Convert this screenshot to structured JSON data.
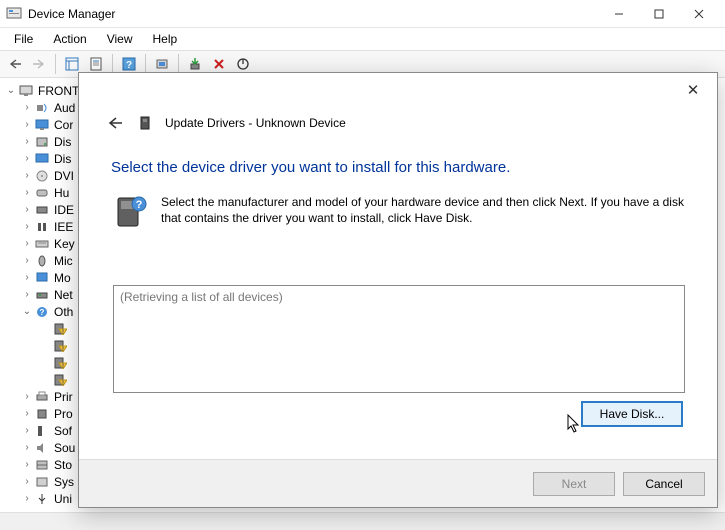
{
  "window": {
    "title": "Device Manager"
  },
  "menu": [
    "File",
    "Action",
    "View",
    "Help"
  ],
  "tree": {
    "root": "FRONT",
    "items": [
      {
        "label": "Aud",
        "icon": "audio"
      },
      {
        "label": "Cor",
        "icon": "computer"
      },
      {
        "label": "Dis",
        "icon": "disk"
      },
      {
        "label": "Dis",
        "icon": "display"
      },
      {
        "label": "DVI",
        "icon": "dvd"
      },
      {
        "label": "Hu",
        "icon": "hid"
      },
      {
        "label": "IDE",
        "icon": "ide"
      },
      {
        "label": "IEE",
        "icon": "ieee"
      },
      {
        "label": "Key",
        "icon": "keyboard"
      },
      {
        "label": "Mic",
        "icon": "mouse"
      },
      {
        "label": "Mo",
        "icon": "monitor"
      },
      {
        "label": "Net",
        "icon": "network"
      },
      {
        "label": "Oth",
        "icon": "other",
        "expanded": true,
        "children": 4
      },
      {
        "label": "Prir",
        "icon": "printer"
      },
      {
        "label": "Pro",
        "icon": "processor"
      },
      {
        "label": "Sof",
        "icon": "software"
      },
      {
        "label": "Sou",
        "icon": "sound"
      },
      {
        "label": "Sto",
        "icon": "storage"
      },
      {
        "label": "Sys",
        "icon": "system"
      },
      {
        "label": "Uni",
        "icon": "usb"
      }
    ]
  },
  "dialog": {
    "title_prefix": "Update Drivers - ",
    "device_name": "Unknown Device",
    "heading": "Select the device driver you want to install for this hardware.",
    "instruction": "Select the manufacturer and model of your hardware device and then click Next. If you have a disk that contains the driver you want to install, click Have Disk.",
    "list_placeholder": "(Retrieving a list of all devices)",
    "have_disk": "Have Disk...",
    "next": "Next",
    "cancel": "Cancel"
  }
}
